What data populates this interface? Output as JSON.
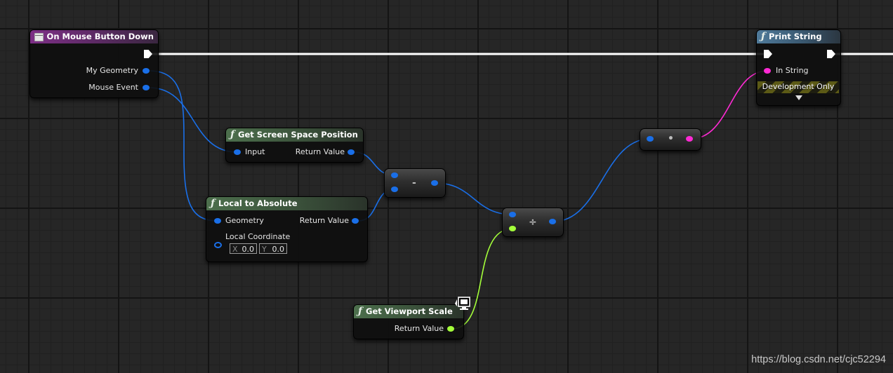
{
  "nodes": {
    "mouse_down": {
      "title": "On Mouse Button Down",
      "pins": {
        "geometry": "My Geometry",
        "mouse_event": "Mouse Event"
      }
    },
    "screen_pos": {
      "title": "Get Screen Space Position",
      "pins": {
        "input": "Input",
        "return": "Return Value"
      }
    },
    "local_abs": {
      "title": "Local to Absolute",
      "pins": {
        "geometry": "Geometry",
        "return": "Return Value",
        "local_coord": "Local Coordinate"
      },
      "local_coordinate": {
        "x_axis": "X",
        "x_value": "0.0",
        "y_axis": "Y",
        "y_value": "0.0"
      }
    },
    "viewport_scale": {
      "title": "Get Viewport Scale",
      "pins": {
        "return": "Return Value"
      }
    },
    "print_string": {
      "title": "Print String",
      "pins": {
        "in_string": "In String"
      },
      "dev_only": "Development Only"
    },
    "subtract": {
      "symbol": "-"
    },
    "divide": {
      "symbol": "÷"
    },
    "to_string": {
      "symbol": "•"
    }
  },
  "watermark": "https://blog.csdn.net/cjc52294",
  "colors": {
    "vector_pin": "#1a6fe8",
    "string_pin": "#ff2ad4",
    "float_pin": "#a4ff3a",
    "exec_wire": "#ffffff"
  },
  "icons": {
    "event": "event-icon",
    "function": "function-icon",
    "client_only": "monitor-icon",
    "expand": "chevron-down-icon"
  }
}
